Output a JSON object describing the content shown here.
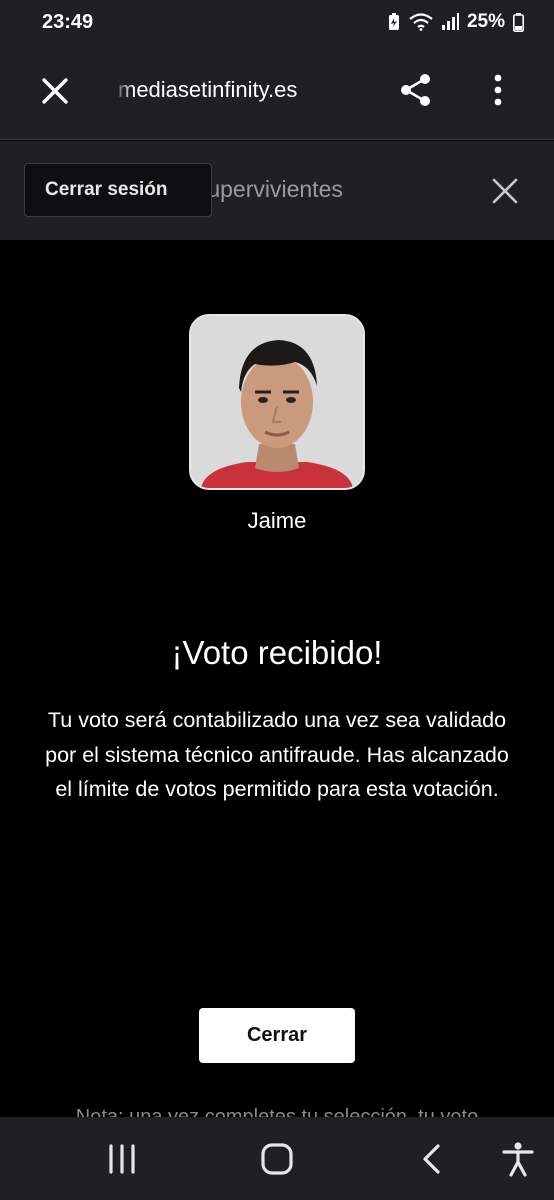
{
  "status_bar": {
    "time": "23:49",
    "battery_percent": "25%",
    "icons": [
      "battery-saver-icon",
      "wifi-icon",
      "signal-icon",
      "battery-icon"
    ]
  },
  "browser": {
    "url": "mediasetinfinity.es",
    "icons": [
      "close-icon",
      "share-icon",
      "more-vert-icon"
    ]
  },
  "subheader": {
    "logout_label": "Cerrar sesión",
    "section_title": "Supervivientes",
    "close_icon": "close-icon"
  },
  "contestant": {
    "name": "Jaime"
  },
  "confirmation": {
    "title": "¡Voto recibido!",
    "message": "Tu voto será contabilizado una vez sea validado por el sistema técnico antifraude. Has alcanzado el límite de votos permitido para esta votación.",
    "button_label": "Cerrar",
    "note_partial": "Nota: una vez completes tu selección, tu voto"
  },
  "navigation": {
    "icons": [
      "recents-icon",
      "home-icon",
      "back-icon",
      "accessibility-icon"
    ]
  },
  "colors": {
    "background": "#000000",
    "bar_background": "#1f2023",
    "button_background": "#ffffff",
    "button_text": "#111111"
  }
}
